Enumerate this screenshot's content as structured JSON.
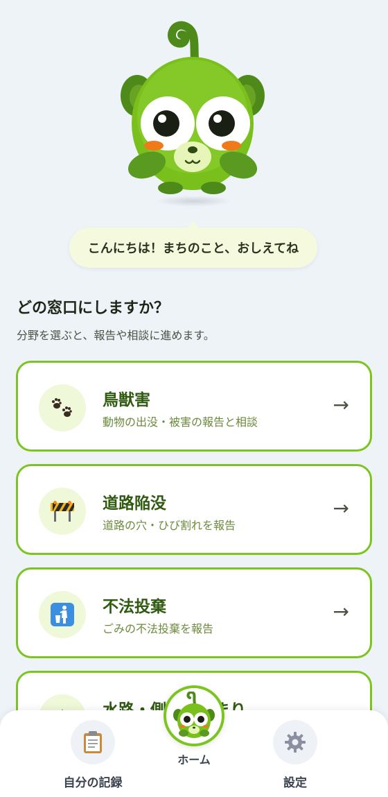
{
  "mascot": {
    "name": "green-monkey-mascot"
  },
  "bubble": {
    "text": "こんにちは！まちのこと、おしえてね"
  },
  "section": {
    "title": "どの窓口にしますか？",
    "subtitle": "分野を選ぶと、報告や相談に進めます。"
  },
  "categories": [
    {
      "title": "鳥獣害",
      "description": "動物の出没・被害の報告と相談",
      "icon": "paw-prints-icon",
      "arrow": "→"
    },
    {
      "title": "道路陥没",
      "description": "道路の穴・ひび割れを報告",
      "icon": "road-barrier-icon",
      "arrow": "→"
    },
    {
      "title": "不法投棄",
      "description": "ごみの不法投棄を報告",
      "icon": "litter-bin-icon",
      "arrow": "→"
    },
    {
      "title": "水路・側溝のつまり",
      "description": "",
      "icon": "water-drop-icon",
      "arrow": "→"
    }
  ],
  "nav": {
    "records_label": "自分の記録",
    "home_label": "ホーム",
    "settings_label": "設定"
  },
  "colors": {
    "accent": "#7cc520",
    "title_green": "#2f5a10",
    "background": "#eef3f8"
  }
}
